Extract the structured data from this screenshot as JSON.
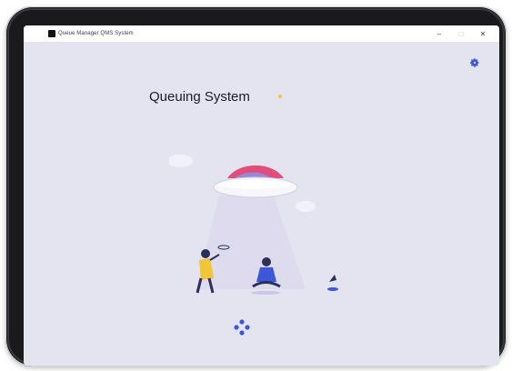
{
  "window": {
    "title": "Queue Manager QMS System",
    "controls": {
      "minimize": "–",
      "maximize": "□",
      "close": "✕"
    }
  },
  "settings": {
    "icon": "gear-icon"
  },
  "main": {
    "heading": "Queuing System",
    "accent_color": "#f2c438"
  },
  "loading": {
    "icon": "loading-dots-icon",
    "color": "#3d57d8"
  },
  "illustration": {
    "subject": "ufo-beam-people-illustration"
  }
}
